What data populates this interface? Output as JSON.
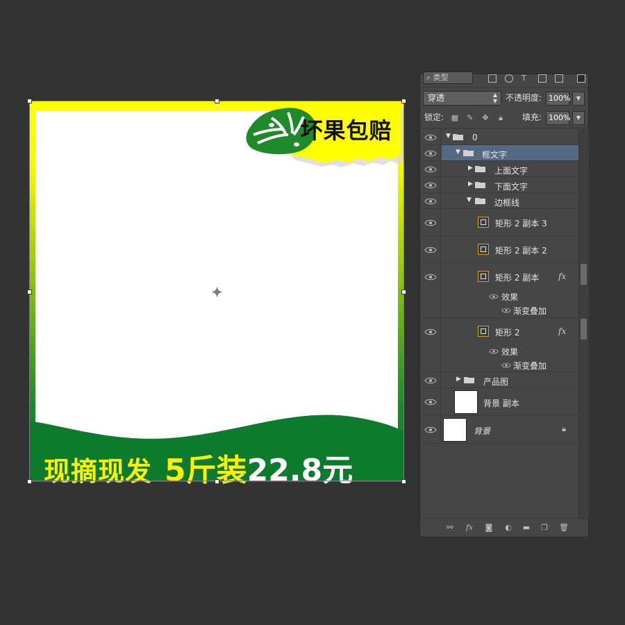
{
  "canvas": {
    "badge_text": "坏果包赔",
    "bottom_left_text": "现摘现发",
    "bottom_num": "5",
    "bottom_unit": "斤装",
    "bottom_price": "22.8",
    "bottom_yuan": "元",
    "colors": {
      "yellow": "#fff200",
      "green": "#0e7a2e",
      "badge_yellow": "#ffff00"
    }
  },
  "layers_panel": {
    "filter_label": "类型",
    "blend_mode": "穿透",
    "opacity_label": "不透明度:",
    "opacity_value": "100%",
    "lock_label": "锁定:",
    "fill_label": "填充:",
    "fill_value": "100%",
    "layers": [
      {
        "name": "0"
      },
      {
        "name": "框文字"
      },
      {
        "name": "上面文字"
      },
      {
        "name": "下面文字"
      },
      {
        "name": "边框线"
      },
      {
        "name": "矩形 2 副本 3"
      },
      {
        "name": "矩形 2 副本 2"
      },
      {
        "name": "矩形 2 副本",
        "fx": "fx",
        "effects_label": "效果",
        "effect_name": "渐变叠加"
      },
      {
        "name": "矩形 2",
        "fx": "fx",
        "effects_label": "效果",
        "effect_name": "渐变叠加"
      },
      {
        "name": "产品图"
      },
      {
        "name": "背景 副本"
      },
      {
        "name": "背景"
      }
    ]
  }
}
